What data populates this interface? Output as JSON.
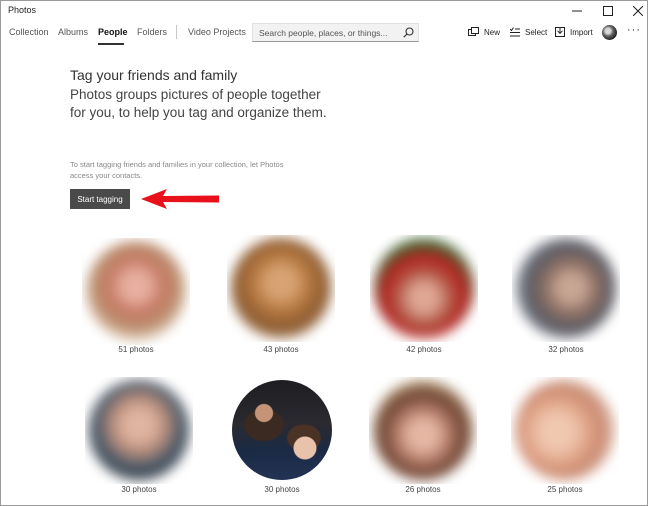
{
  "window": {
    "title": "Photos"
  },
  "nav": {
    "tabs": [
      {
        "label": "Collection",
        "active": false
      },
      {
        "label": "Albums",
        "active": false
      },
      {
        "label": "People",
        "active": true
      },
      {
        "label": "Folders",
        "active": false
      },
      {
        "label": "Video Projects",
        "active": false
      }
    ]
  },
  "search": {
    "placeholder": "Search people, places, or things..."
  },
  "toolbar": {
    "new_label": "New",
    "select_label": "Select",
    "import_label": "Import",
    "more_label": "···"
  },
  "hero": {
    "title": "Tag your friends and family",
    "description": "Photos groups pictures of people together for you, to help you tag and organize them.",
    "hint": "To start tagging friends and families in your collection, let Photos access your contacts.",
    "button_label": "Start tagging"
  },
  "people": [
    {
      "count": "51 photos"
    },
    {
      "count": "43 photos"
    },
    {
      "count": "42 photos"
    },
    {
      "count": "32 photos"
    },
    {
      "count": "30 photos"
    },
    {
      "count": "30 photos"
    },
    {
      "count": "26 photos"
    },
    {
      "count": "25 photos"
    }
  ],
  "colors": {
    "accent_arrow": "#e8101a",
    "button_bg": "#4a4a4a"
  }
}
